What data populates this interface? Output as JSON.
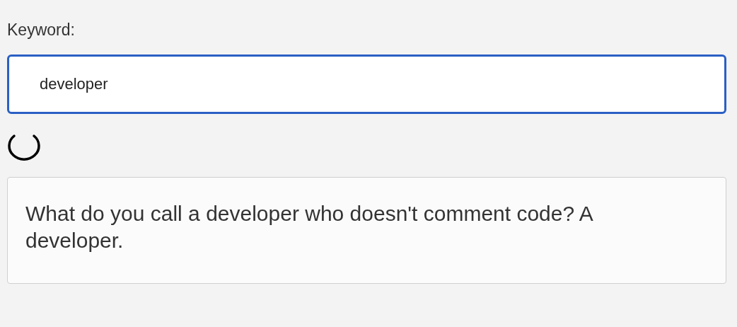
{
  "search": {
    "label": "Keyword:",
    "value": "developer",
    "focused": true
  },
  "loading": true,
  "result": {
    "text": "What do you call a developer who doesn't comment code? A developer."
  }
}
